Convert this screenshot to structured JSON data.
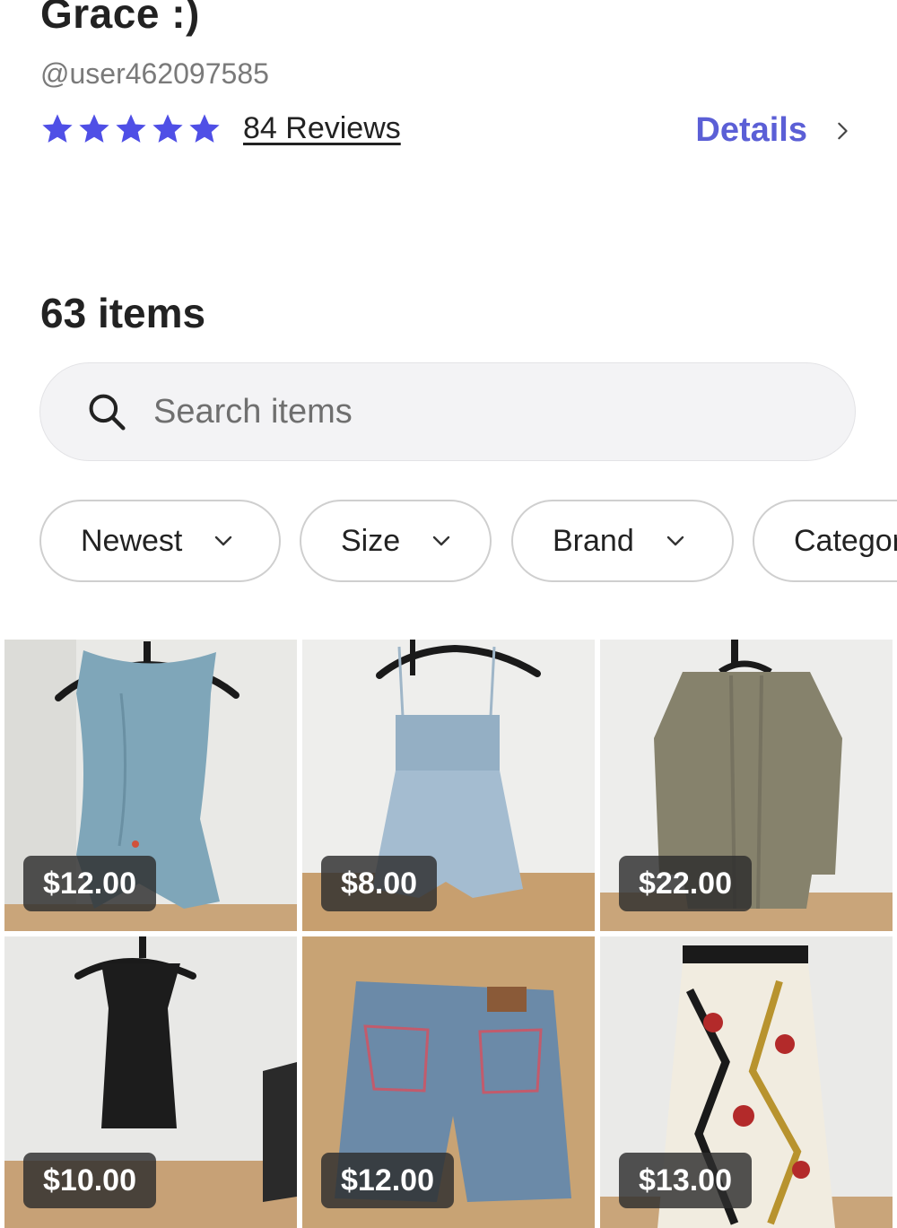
{
  "profile": {
    "name": "Grace :)",
    "handle": "@user462097585",
    "rating_stars": 5,
    "reviews_label": "84 Reviews",
    "details_label": "Details"
  },
  "listing": {
    "count_label": "63 items"
  },
  "search": {
    "placeholder": "Search items",
    "value": ""
  },
  "filters": [
    {
      "label": "Newest"
    },
    {
      "label": "Size"
    },
    {
      "label": "Brand"
    },
    {
      "label": "Category"
    }
  ],
  "items": [
    {
      "price": "$12.00",
      "image": "blue-sleeveless-top"
    },
    {
      "price": "$8.00",
      "image": "chambray-babydoll-top"
    },
    {
      "price": "$22.00",
      "image": "olive-knit-cardigan"
    },
    {
      "price": "$10.00",
      "image": "black-mesh-tank-top"
    },
    {
      "price": "$12.00",
      "image": "denim-shorts"
    },
    {
      "price": "$13.00",
      "image": "floral-pleated-skirt"
    }
  ],
  "colors": {
    "accent": "#5b5fd6",
    "star": "#4f4fe6",
    "price_badge": "#2d2d2d"
  }
}
